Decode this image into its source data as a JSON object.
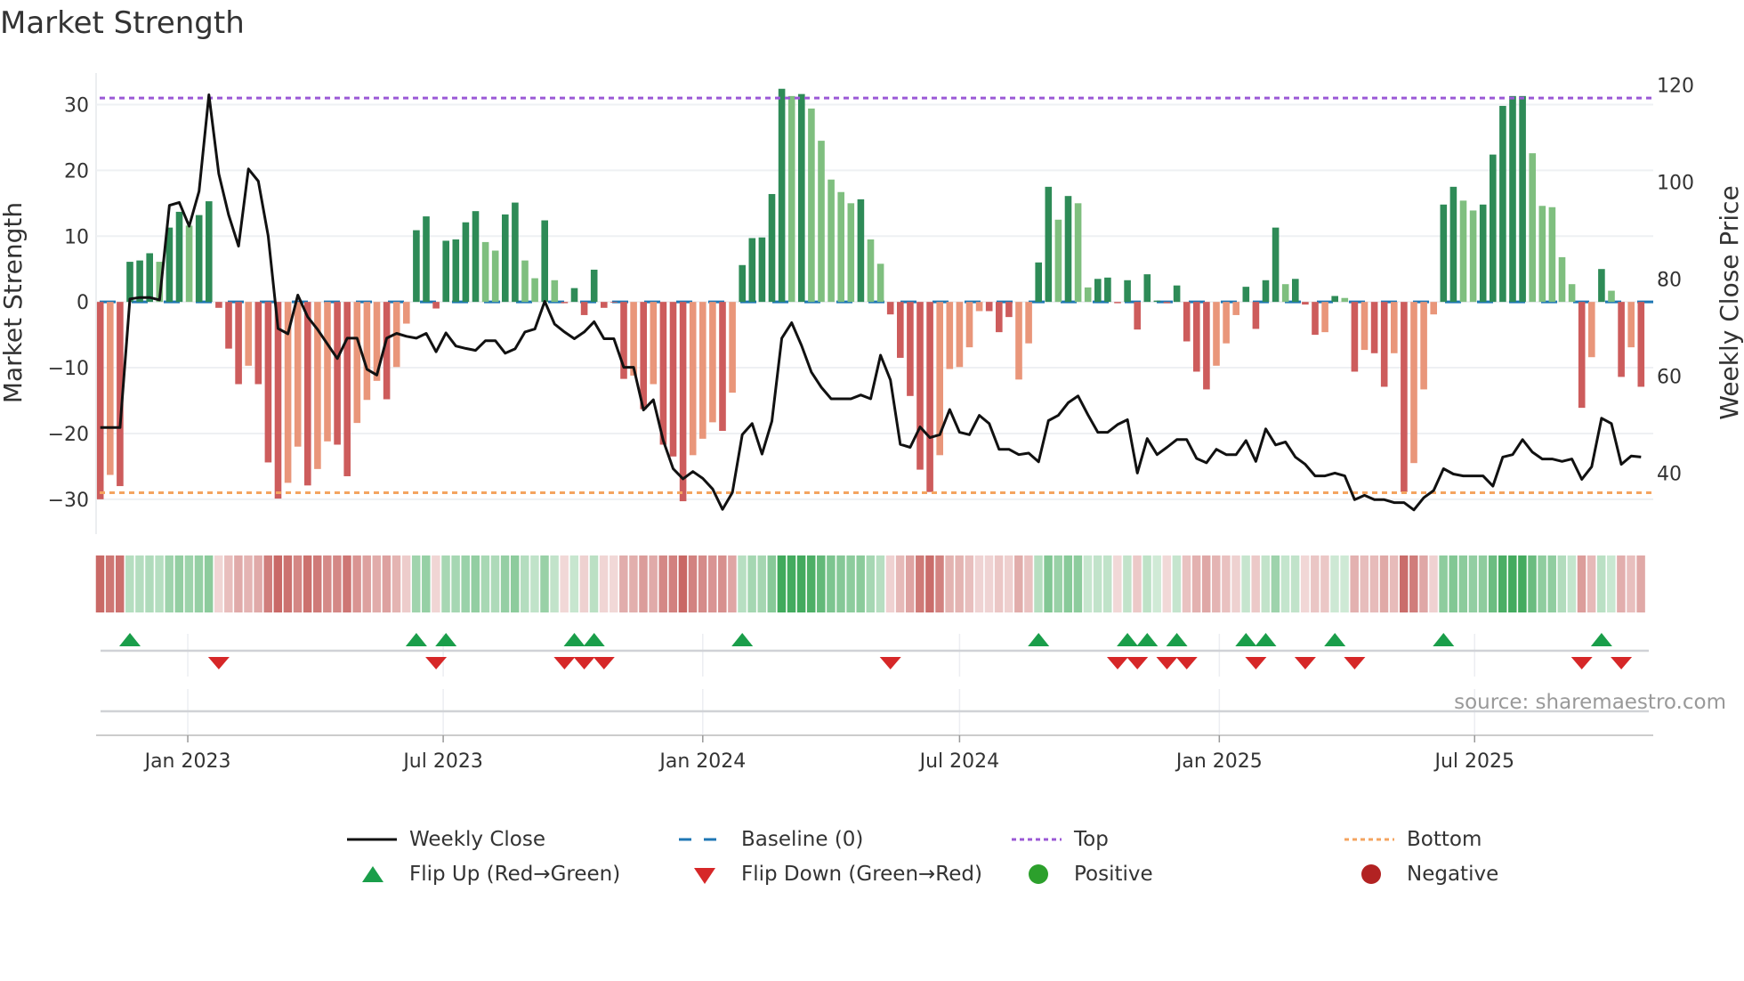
{
  "title": "Market Strength",
  "source": "source: sharemaestro.com",
  "colors": {
    "pos_dark": "#2e8b57",
    "pos_light": "#7fbf7f",
    "neg_dark": "#cd5c5c",
    "neg_light": "#e9967a",
    "strip_pos": "#2ca04a",
    "strip_neg": "#c0504d",
    "close": "#111111",
    "baseline": "#1f77b4",
    "top": "#9b59d6",
    "bottom": "#f4a460",
    "flip_up": "#1a9e4a",
    "flip_down": "#d62728",
    "positive": "#2ca02c",
    "negative": "#b22222"
  },
  "legend": {
    "weekly_close": "Weekly Close",
    "baseline": "Baseline (0)",
    "top": "Top",
    "bottom": "Bottom",
    "flip_up": "Flip Up (Red→Green)",
    "flip_down": "Flip Down (Green→Red)",
    "positive": "Positive",
    "negative": "Negative"
  },
  "chart_data": {
    "type": "bar",
    "title": "Market Strength",
    "ylabel": "Market Strength",
    "y2label": "Weekly Close Price",
    "xlabel": "",
    "ylim": [
      -35.3,
      34.8
    ],
    "y2lim": [
      27.4,
      122.5
    ],
    "yticks": [
      30,
      20,
      10,
      0,
      -10,
      -20,
      -30
    ],
    "ytick_labels": [
      "30",
      "20",
      "10",
      "0",
      "−10",
      "−20",
      "−30"
    ],
    "y2ticks": [
      120,
      100,
      80,
      60,
      40
    ],
    "y2tick_labels": [
      "120",
      "100",
      "80",
      "60",
      "40"
    ],
    "top_level": 31,
    "bottom_level": -29,
    "baseline": 0,
    "grid": true,
    "legend_position": "bottom",
    "x_unit": "week index",
    "x_ticks": [
      {
        "label": "Jan 2023",
        "pos": 8.86
      },
      {
        "label": "Jul 2023",
        "pos": 34.72
      },
      {
        "label": "Jan 2024",
        "pos": 61.0
      },
      {
        "label": "Jul 2024",
        "pos": 87.0
      },
      {
        "label": "Jan 2025",
        "pos": 113.3
      },
      {
        "label": "Jul 2025",
        "pos": 139.15
      }
    ],
    "strength": [
      -30,
      -26.3,
      -28,
      6.1,
      6.3,
      7.4,
      6.1,
      11.3,
      13.7,
      11.6,
      13.2,
      15.3,
      -0.9,
      -7.1,
      -12.5,
      -9.7,
      -12.5,
      -24.4,
      -29.9,
      -27.5,
      -22,
      -27.9,
      -25.4,
      -21.2,
      -21.7,
      -26.5,
      -18.4,
      -14.9,
      -12,
      -14.8,
      -9.9,
      -3.3,
      10.9,
      13.0,
      -1.0,
      9.3,
      9.5,
      12.1,
      13.8,
      9.1,
      7.8,
      13.3,
      15.1,
      6.3,
      3.6,
      12.4,
      3.3,
      -0.2,
      2.1,
      -2.0,
      4.9,
      -0.9,
      -0.1,
      -11.7,
      -11.2,
      -16.3,
      -12.5,
      -21.7,
      -23.5,
      -30.3,
      -23.3,
      -20.8,
      -18.3,
      -19.6,
      -13.8,
      5.6,
      9.7,
      9.8,
      16.4,
      32.4,
      31.3,
      31.6,
      29.4,
      24.5,
      18.6,
      16.7,
      15.0,
      15.6,
      9.5,
      5.8,
      -1.9,
      -8.5,
      -14.3,
      -25.5,
      -28.9,
      -23.3,
      -10.2,
      -9.9,
      -6.9,
      -1.4,
      -1.4,
      -4.6,
      -2.3,
      -11.8,
      -6.3,
      6.0,
      17.5,
      12.5,
      16.1,
      15.0,
      2.2,
      3.5,
      3.7,
      -0.2,
      3.3,
      -4.2,
      4.2,
      0.2,
      -0.2,
      2.5,
      -6.0,
      -10.6,
      -13.3,
      -9.7,
      -6.3,
      -2.0,
      2.3,
      -4.1,
      3.3,
      11.3,
      2.7,
      3.5,
      -0.4,
      -5.0,
      -4.6,
      0.9,
      0.6,
      -10.6,
      -7.3,
      -7.8,
      -12.9,
      -7.8,
      -28.9,
      -24.5,
      -13.3,
      -1.9,
      14.8,
      17.5,
      15.4,
      13.9,
      14.8,
      22.4,
      29.8,
      31.3,
      31.3,
      22.6,
      14.6,
      14.4,
      6.8,
      2.7,
      -16.1,
      -8.4,
      5.0,
      1.7,
      -11.4,
      -6.9,
      -12.9
    ],
    "shade": "dlddddlddlddd",
    "shade_parts": [
      "dlddddlddlddd",
      "ddldddlldllddllldll",
      "dddddddll",
      "ddlldldddddd",
      "dldldddllldl",
      "dddddldllllldll",
      "dddddllllldddl",
      "l",
      "ddldlldddd",
      "ddddd",
      "dddlll",
      "ddddl",
      "dddldl",
      "dlddldlll",
      "ddlldddddlllll",
      "dldldld"
    ],
    "close": [
      49.4,
      49.4,
      49.4,
      75.9,
      76.2,
      76.2,
      75.7,
      95.2,
      95.8,
      90.9,
      98.1,
      118.0,
      101.7,
      93.2,
      86.8,
      102.7,
      100.2,
      88.9,
      69.8,
      68.7,
      76.7,
      72.2,
      69.6,
      66.6,
      63.6,
      67.8,
      67.8,
      61.4,
      60.2,
      67.8,
      68.8,
      68.2,
      67.8,
      68.8,
      65.0,
      68.9,
      66.2,
      65.7,
      65.3,
      67.3,
      67.3,
      64.7,
      65.6,
      69.1,
      69.7,
      75.4,
      70.7,
      69.1,
      67.7,
      69.1,
      71.2,
      67.7,
      67.7,
      61.8,
      61.8,
      53.0,
      55.1,
      46.7,
      40.9,
      38.8,
      40.3,
      38.9,
      36.7,
      32.5,
      36.0,
      47.9,
      50.2,
      43.9,
      50.7,
      67.8,
      71.0,
      66.3,
      60.8,
      57.7,
      55.3,
      55.3,
      55.3,
      56.1,
      55.3,
      64.3,
      59.2,
      45.9,
      45.3,
      49.5,
      47.3,
      47.9,
      53.1,
      48.4,
      47.9,
      51.9,
      50.2,
      44.9,
      44.9,
      43.8,
      44.1,
      42.3,
      50.8,
      51.9,
      54.5,
      55.9,
      52.0,
      48.4,
      48.4,
      50.0,
      51.0,
      40.0,
      47.1,
      43.8,
      45.3,
      46.9,
      46.9,
      43.0,
      42.1,
      44.9,
      43.8,
      43.8,
      46.7,
      42.4,
      49.1,
      45.8,
      46.4,
      43.3,
      41.8,
      39.4,
      39.4,
      40.0,
      39.4,
      34.5,
      35.4,
      34.5,
      34.5,
      33.9,
      33.9,
      32.4,
      34.9,
      36.4,
      40.9,
      39.8,
      39.4,
      39.4,
      39.4,
      37.3,
      43.3,
      43.8,
      46.9,
      44.3,
      42.9,
      42.9,
      42.4,
      42.9,
      38.7,
      41.3,
      51.3,
      50.2,
      41.8,
      43.5,
      43.3
    ],
    "flip_up": [
      3,
      32,
      35,
      48,
      50,
      65,
      95,
      104,
      106,
      109,
      116,
      118,
      125,
      136,
      152
    ],
    "flip_down": [
      12,
      34,
      47,
      49,
      51,
      80,
      103,
      105,
      108,
      110,
      117,
      122,
      127,
      150,
      154
    ]
  }
}
